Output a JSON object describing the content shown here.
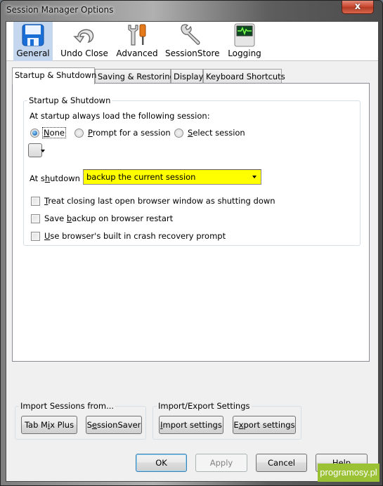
{
  "window": {
    "title": "Session Manager Options",
    "close_label": "x"
  },
  "toolbar": {
    "items": [
      {
        "label": "General",
        "icon": "floppy-disk-icon",
        "selected": true
      },
      {
        "label": "Undo Close",
        "icon": "undo-arrow-icon"
      },
      {
        "label": "Advanced",
        "icon": "tools-icon"
      },
      {
        "label": "SessionStore",
        "icon": "wrench-icon"
      },
      {
        "label": "Logging",
        "icon": "monitor-log-icon"
      }
    ]
  },
  "tabs": [
    {
      "label": "Startup & Shutdown",
      "active": true
    },
    {
      "label": "Saving & Restoring"
    },
    {
      "label": "Display"
    },
    {
      "label": "Keyboard Shortcuts"
    }
  ],
  "startup": {
    "group_label": "Startup & Shutdown",
    "load_label": "At startup always load the following session:",
    "radios": [
      {
        "label_accel": "N",
        "label_rest": "one",
        "checked": true
      },
      {
        "label_accel": "P",
        "label_rest": "rompt for a session",
        "checked": false
      },
      {
        "label_accel": "S",
        "label_rest": "elect session",
        "checked": false
      }
    ],
    "shutdown_label_pre": "At s",
    "shutdown_label_accel": "h",
    "shutdown_label_post": "utdown",
    "shutdown_value": "backup the current session",
    "shutdown_bg": "#ffff00",
    "checkboxes": [
      {
        "pre": "",
        "accel": "T",
        "post": "reat closing last open browser window as shutting down",
        "checked": false
      },
      {
        "pre": "Save ",
        "accel": "b",
        "post": "ackup on browser restart",
        "checked": false
      },
      {
        "pre": "",
        "accel": "U",
        "post": "se browser's built in crash recovery prompt",
        "checked": false
      }
    ]
  },
  "import_sessions": {
    "group_label": "Import Sessions from...",
    "buttons": [
      {
        "pre": "Tab M",
        "accel": "i",
        "post": "x Plus"
      },
      {
        "pre": "S",
        "accel": "e",
        "post": "ssionSaver"
      }
    ]
  },
  "import_export": {
    "group_label": "Import/Export Settings",
    "buttons": [
      {
        "pre": "",
        "accel": "I",
        "post": "mport settings"
      },
      {
        "pre": "E",
        "accel": "x",
        "post": "port settings"
      }
    ]
  },
  "dialog_buttons": {
    "ok": "OK",
    "apply": "Apply",
    "cancel": "Cancel",
    "help_accel": "H",
    "help_rest": "elp"
  },
  "watermark": "programosy.pl"
}
